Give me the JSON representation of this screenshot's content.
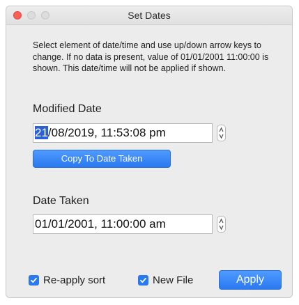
{
  "window": {
    "title": "Set Dates"
  },
  "description": "Select element of date/time and use up/down arrow keys to change. If no data is present, value of 01/01/2001 11:00:00 is shown. This date/time will not be applied if shown.",
  "modified": {
    "label": "Modified Date",
    "selected_segment": "21",
    "rest": "/08/2019, 11:53:08 pm",
    "copy_button": "Copy To Date Taken"
  },
  "taken": {
    "label": "Date Taken",
    "value": "01/01/2001, 11:00:00 am"
  },
  "footer": {
    "reapply_sort": {
      "label": "Re-apply sort",
      "checked": true
    },
    "new_file": {
      "label": "New File",
      "checked": true
    },
    "apply_button": "Apply"
  },
  "colors": {
    "accent": "#2a79f0",
    "close": "#fc5f57",
    "selection": "#2a62d6"
  },
  "icons": [
    "stepper-icon",
    "checkmark-icon"
  ]
}
